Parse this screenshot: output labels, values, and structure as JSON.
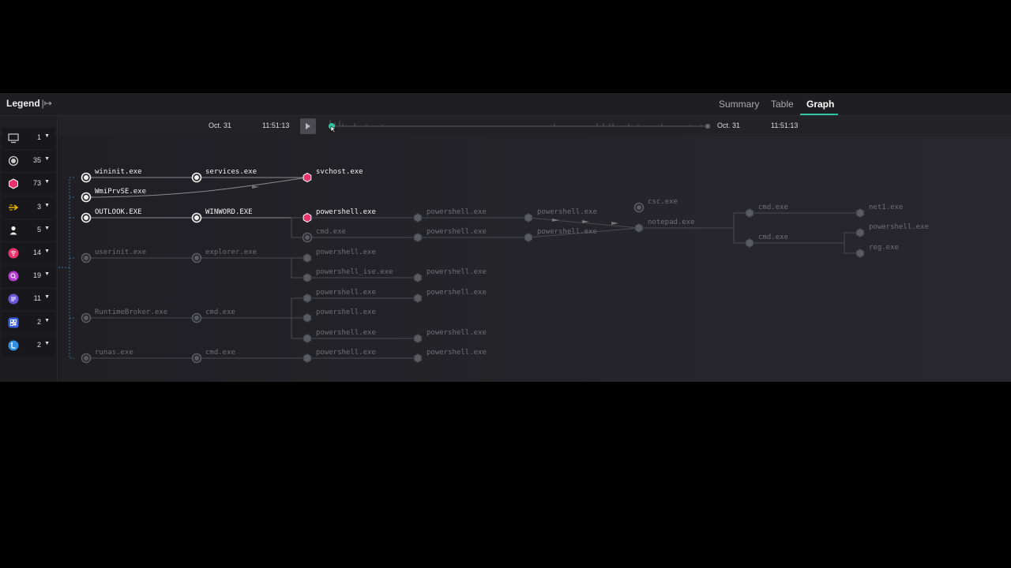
{
  "legend": {
    "label": "Legend",
    "expand_icon": "expand-arrow-icon"
  },
  "tabs": [
    {
      "label": "Summary",
      "active": false
    },
    {
      "label": "Table",
      "active": false
    },
    {
      "label": "Graph",
      "active": true
    }
  ],
  "accent_color": "#2ec4a0",
  "alert_color": "#e8336d",
  "timeline": {
    "start_date": "Oct. 31",
    "start_time": "11:51:13",
    "end_date": "Oct. 31",
    "end_time": "11:51:13",
    "play_icon": "play-icon"
  },
  "filters": [
    {
      "icon": "monitor-icon",
      "count": "1"
    },
    {
      "icon": "process-circle-icon",
      "count": "35"
    },
    {
      "icon": "alert-hexagon-icon",
      "count": "73"
    },
    {
      "icon": "network-arrow-icon",
      "count": "3"
    },
    {
      "icon": "user-icon",
      "count": "5"
    },
    {
      "icon": "signal-icon",
      "count": "14"
    },
    {
      "icon": "search-scan-icon",
      "count": "19"
    },
    {
      "icon": "document-list-icon",
      "count": "11"
    },
    {
      "icon": "registry-grid-icon",
      "count": "2"
    },
    {
      "icon": "connection-icon",
      "count": "2"
    }
  ],
  "graph": {
    "nodes": [
      {
        "id": "n1",
        "label": "wininit.exe",
        "shape": "circle",
        "active": true
      },
      {
        "id": "n2",
        "label": "services.exe",
        "shape": "circle",
        "active": true
      },
      {
        "id": "n3",
        "label": "svchost.exe",
        "shape": "hex",
        "active": true,
        "alert": true
      },
      {
        "id": "n4",
        "label": "WmiPrvSE.exe",
        "shape": "circle",
        "active": true
      },
      {
        "id": "n5",
        "label": "OUTLOOK.EXE",
        "shape": "circle",
        "active": true
      },
      {
        "id": "n6",
        "label": "WINWORD.EXE",
        "shape": "circle",
        "active": true
      },
      {
        "id": "n7",
        "label": "powershell.exe",
        "shape": "hex",
        "active": true,
        "alert": true
      },
      {
        "id": "n8",
        "label": "powershell.exe",
        "shape": "hex",
        "active": false
      },
      {
        "id": "n9",
        "label": "powershell.exe",
        "shape": "hex",
        "active": false
      },
      {
        "id": "n10",
        "label": "csc.exe",
        "shape": "circle",
        "active": false
      },
      {
        "id": "n11",
        "label": "notepad.exe",
        "shape": "hex",
        "active": false
      },
      {
        "id": "n12",
        "label": "cmd.exe",
        "shape": "hex",
        "active": false
      },
      {
        "id": "n13",
        "label": "net1.exe",
        "shape": "hex",
        "active": false
      },
      {
        "id": "n14",
        "label": "cmd.exe",
        "shape": "hex",
        "active": false
      },
      {
        "id": "n15",
        "label": "powershell.exe",
        "shape": "hex",
        "active": false
      },
      {
        "id": "n16",
        "label": "reg.exe",
        "shape": "hex",
        "active": false
      },
      {
        "id": "n17",
        "label": "cmd.exe",
        "shape": "circle",
        "active": false
      },
      {
        "id": "n18",
        "label": "powershell.exe",
        "shape": "hex",
        "active": false
      },
      {
        "id": "n19",
        "label": "powershell.exe",
        "shape": "hex",
        "active": false
      },
      {
        "id": "n20",
        "label": "userinit.exe",
        "shape": "circle",
        "active": false
      },
      {
        "id": "n21",
        "label": "explorer.exe",
        "shape": "circle",
        "active": false
      },
      {
        "id": "n22",
        "label": "powershell.exe",
        "shape": "hex",
        "active": false
      },
      {
        "id": "n23",
        "label": "powershell_ise.exe",
        "shape": "hex",
        "active": false
      },
      {
        "id": "n24",
        "label": "powershell.exe",
        "shape": "hex",
        "active": false
      },
      {
        "id": "n25",
        "label": "powershell.exe",
        "shape": "hex",
        "active": false
      },
      {
        "id": "n26",
        "label": "powershell.exe",
        "shape": "hex",
        "active": false
      },
      {
        "id": "n27",
        "label": "RuntimeBroker.exe",
        "shape": "circle",
        "active": false
      },
      {
        "id": "n28",
        "label": "cmd.exe",
        "shape": "circle",
        "active": false
      },
      {
        "id": "n29",
        "label": "powershell.exe",
        "shape": "hex",
        "active": false
      },
      {
        "id": "n30",
        "label": "powershell.exe",
        "shape": "hex",
        "active": false
      },
      {
        "id": "n31",
        "label": "powershell.exe",
        "shape": "hex",
        "active": false
      },
      {
        "id": "n32",
        "label": "runas.exe",
        "shape": "circle",
        "active": false
      },
      {
        "id": "n33",
        "label": "cmd.exe",
        "shape": "circle",
        "active": false
      },
      {
        "id": "n34",
        "label": "powershell.exe",
        "shape": "hex",
        "active": false
      },
      {
        "id": "n35",
        "label": "powershell.exe",
        "shape": "hex",
        "active": false
      }
    ],
    "edges": [
      [
        "n1",
        "n2"
      ],
      [
        "n2",
        "n3"
      ],
      [
        "n4",
        "n3"
      ],
      [
        "n5",
        "n6"
      ],
      [
        "n6",
        "n7"
      ],
      [
        "n7",
        "n8"
      ],
      [
        "n8",
        "n9"
      ],
      [
        "n9",
        "n11"
      ],
      [
        "n19",
        "n11"
      ],
      [
        "n11",
        "n12"
      ],
      [
        "n11",
        "n14"
      ],
      [
        "n12",
        "n13"
      ],
      [
        "n14",
        "n15"
      ],
      [
        "n14",
        "n16"
      ],
      [
        "n7",
        "n17"
      ],
      [
        "n17",
        "n18"
      ],
      [
        "n18",
        "n19"
      ],
      [
        "n20",
        "n21"
      ],
      [
        "n21",
        "n22"
      ],
      [
        "n21",
        "n23"
      ],
      [
        "n23",
        "n24"
      ],
      [
        "n27",
        "n28"
      ],
      [
        "n28",
        "n25"
      ],
      [
        "n28",
        "n29"
      ],
      [
        "n28",
        "n30"
      ],
      [
        "n25",
        "n26"
      ],
      [
        "n30",
        "n31"
      ],
      [
        "n32",
        "n33"
      ],
      [
        "n33",
        "n34"
      ],
      [
        "n34",
        "n35"
      ]
    ]
  }
}
